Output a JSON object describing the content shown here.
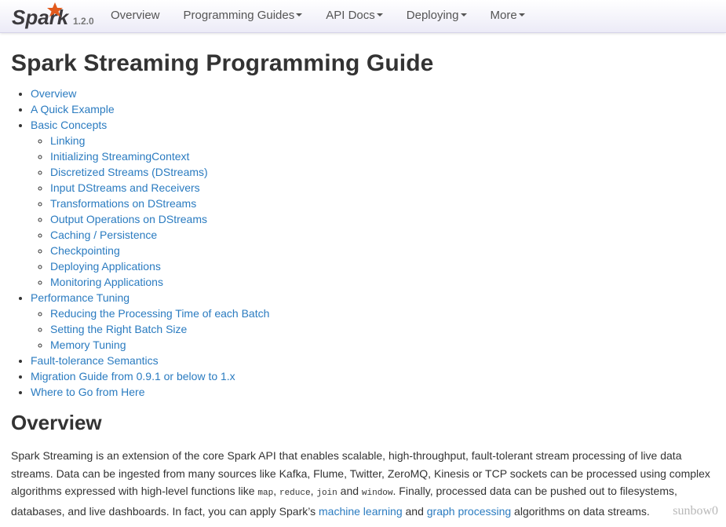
{
  "brand": {
    "name": "Spark",
    "version": "1.2.0",
    "accent": "#e25a1c"
  },
  "nav": {
    "items": [
      {
        "label": "Overview",
        "dropdown": false
      },
      {
        "label": "Programming Guides",
        "dropdown": true
      },
      {
        "label": "API Docs",
        "dropdown": true
      },
      {
        "label": "Deploying",
        "dropdown": true
      },
      {
        "label": "More",
        "dropdown": true
      }
    ]
  },
  "page": {
    "title": "Spark Streaming Programming Guide"
  },
  "toc": {
    "overview": "Overview",
    "quick_example": "A Quick Example",
    "basic_concepts": {
      "label": "Basic Concepts",
      "children": [
        "Linking",
        "Initializing StreamingContext",
        "Discretized Streams (DStreams)",
        "Input DStreams and Receivers",
        "Transformations on DStreams",
        "Output Operations on DStreams",
        "Caching / Persistence",
        "Checkpointing",
        "Deploying Applications",
        "Monitoring Applications"
      ]
    },
    "performance_tuning": {
      "label": "Performance Tuning",
      "children": [
        "Reducing the Processing Time of each Batch",
        "Setting the Right Batch Size",
        "Memory Tuning"
      ]
    },
    "fault_tolerance": "Fault-tolerance Semantics",
    "migration": "Migration Guide from 0.9.1 or below to 1.x",
    "where_to_go": "Where to Go from Here"
  },
  "overview": {
    "heading": "Overview",
    "text_1": "Spark Streaming is an extension of the core Spark API that enables scalable, high-throughput, fault-tolerant stream processing of live data streams. Data can be ingested from many sources like Kafka, Flume, Twitter, ZeroMQ, Kinesis or TCP sockets can be processed using complex algorithms expressed with high-level functions like ",
    "code_map": "map",
    "sep_1": ", ",
    "code_reduce": "reduce",
    "sep_2": ", ",
    "code_join": "join",
    "sep_3": " and ",
    "code_window": "window",
    "text_2": ". Finally, processed data can be pushed out to filesystems, databases, and live dashboards. In fact, you can apply Spark’s ",
    "link_ml": "machine learning",
    "text_3": " and ",
    "link_graph": "graph processing",
    "text_4": " algorithms on data streams."
  },
  "watermark": "sunbow0",
  "colors": {
    "link": "#2a7bc0",
    "text": "#333333",
    "nav_text": "#555555"
  }
}
